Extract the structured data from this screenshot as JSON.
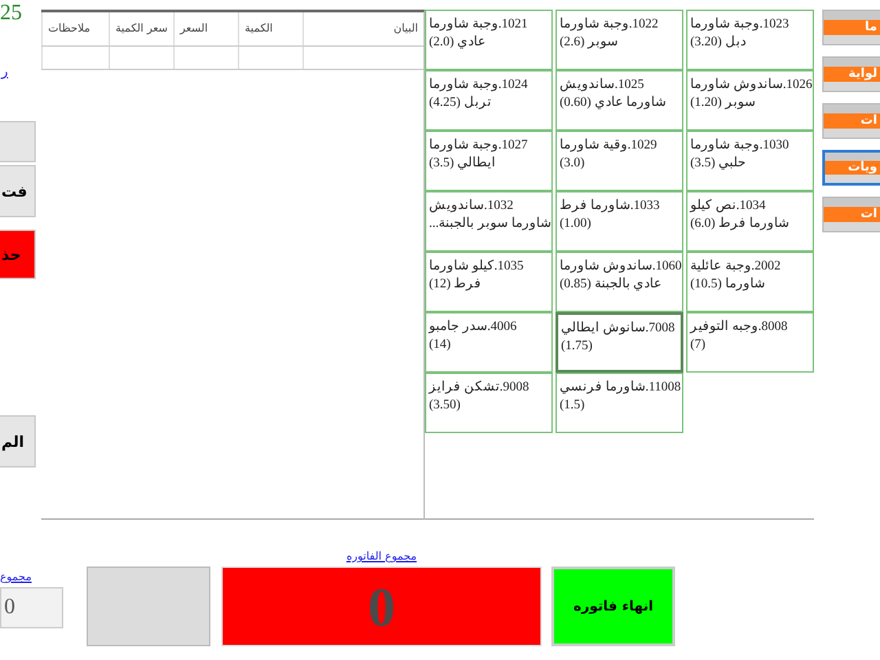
{
  "left_panel": {
    "counter": "25",
    "link": "ر",
    "buttons": [
      {
        "kind": "plain"
      },
      {
        "label": "فت",
        "kind": "plain"
      },
      {
        "label": "حذ",
        "kind": "danger"
      },
      {
        "label": "الم",
        "kind": "plain"
      }
    ]
  },
  "invoice_table": {
    "columns": [
      "البيان",
      "الكمية",
      "السعر",
      "سعر الكمية",
      "ملاحظات"
    ],
    "rows": [
      [
        "",
        "",
        "",
        "",
        ""
      ]
    ]
  },
  "products": [
    {
      "lines": [
        "1023.وجبة شاورما",
        "دبل (3.20)"
      ],
      "focused": false
    },
    {
      "lines": [
        "1022.وجبة شاورما",
        "سوبر (2.6)"
      ],
      "focused": false
    },
    {
      "lines": [
        "1021.وجبة شاورما",
        "عادي (2.0)"
      ],
      "focused": false
    },
    {
      "lines": [
        "1026.ساندوش شاورما",
        "سوبر (1.20)"
      ],
      "focused": false
    },
    {
      "lines": [
        "1025.ساندويش",
        "شاورما عادي (0.60)"
      ],
      "focused": false
    },
    {
      "lines": [
        "1024.وجبة شاورما",
        "تربل (4.25)"
      ],
      "focused": false
    },
    {
      "lines": [
        "1030.وجبة شاورما",
        "حلبي (3.5)"
      ],
      "focused": false
    },
    {
      "lines": [
        "1029.وقية شاورما",
        "(3.0)"
      ],
      "focused": false
    },
    {
      "lines": [
        "1027.وجبة شاورما",
        "ايطالي (3.5)"
      ],
      "focused": false
    },
    {
      "lines": [
        "1034.نص كيلو",
        "شاورما فرط (6.0)"
      ],
      "focused": false
    },
    {
      "lines": [
        "1033.شاورما فرط",
        "(1.00)"
      ],
      "focused": false
    },
    {
      "lines": [
        "1032.ساندويش",
        "شاورما سوبر بالجبنة..."
      ],
      "focused": false
    },
    {
      "lines": [
        "2002.وجبة عائلية",
        "شاورما (10.5)"
      ],
      "focused": false
    },
    {
      "lines": [
        "1060.ساندوش شاورما",
        "عادي بالجبنة (0.85)"
      ],
      "focused": false
    },
    {
      "lines": [
        "1035.كيلو شاورما",
        "فرط (12)"
      ],
      "focused": false
    },
    {
      "lines": [
        "8008.وجبه التوفير",
        "(7)"
      ],
      "focused": false
    },
    {
      "lines": [
        "7008.سانوش ايطالي",
        "(1.75)"
      ],
      "focused": true
    },
    {
      "lines": [
        "4006.سدر جامبو",
        "(14)"
      ],
      "focused": false
    },
    {
      "lines": [
        "11008.شاورما فرنسي",
        "(1.5)"
      ],
      "focused": false
    },
    {
      "lines": [
        "9008.تشكن فرايز",
        "(3.50)"
      ],
      "focused": false
    }
  ],
  "categories": [
    {
      "label": "ما",
      "selected": false
    },
    {
      "label": "لواية",
      "selected": false
    },
    {
      "label": "ات",
      "selected": false
    },
    {
      "label": "ويات",
      "selected": true
    },
    {
      "label": "ات",
      "selected": false
    }
  ],
  "footer": {
    "sum_link": "مجموع",
    "sum_value": "0",
    "invoice_total_link": "مجموع الفاتوره",
    "invoice_total": "0",
    "finish_button": "انهاء فاتوره"
  }
}
